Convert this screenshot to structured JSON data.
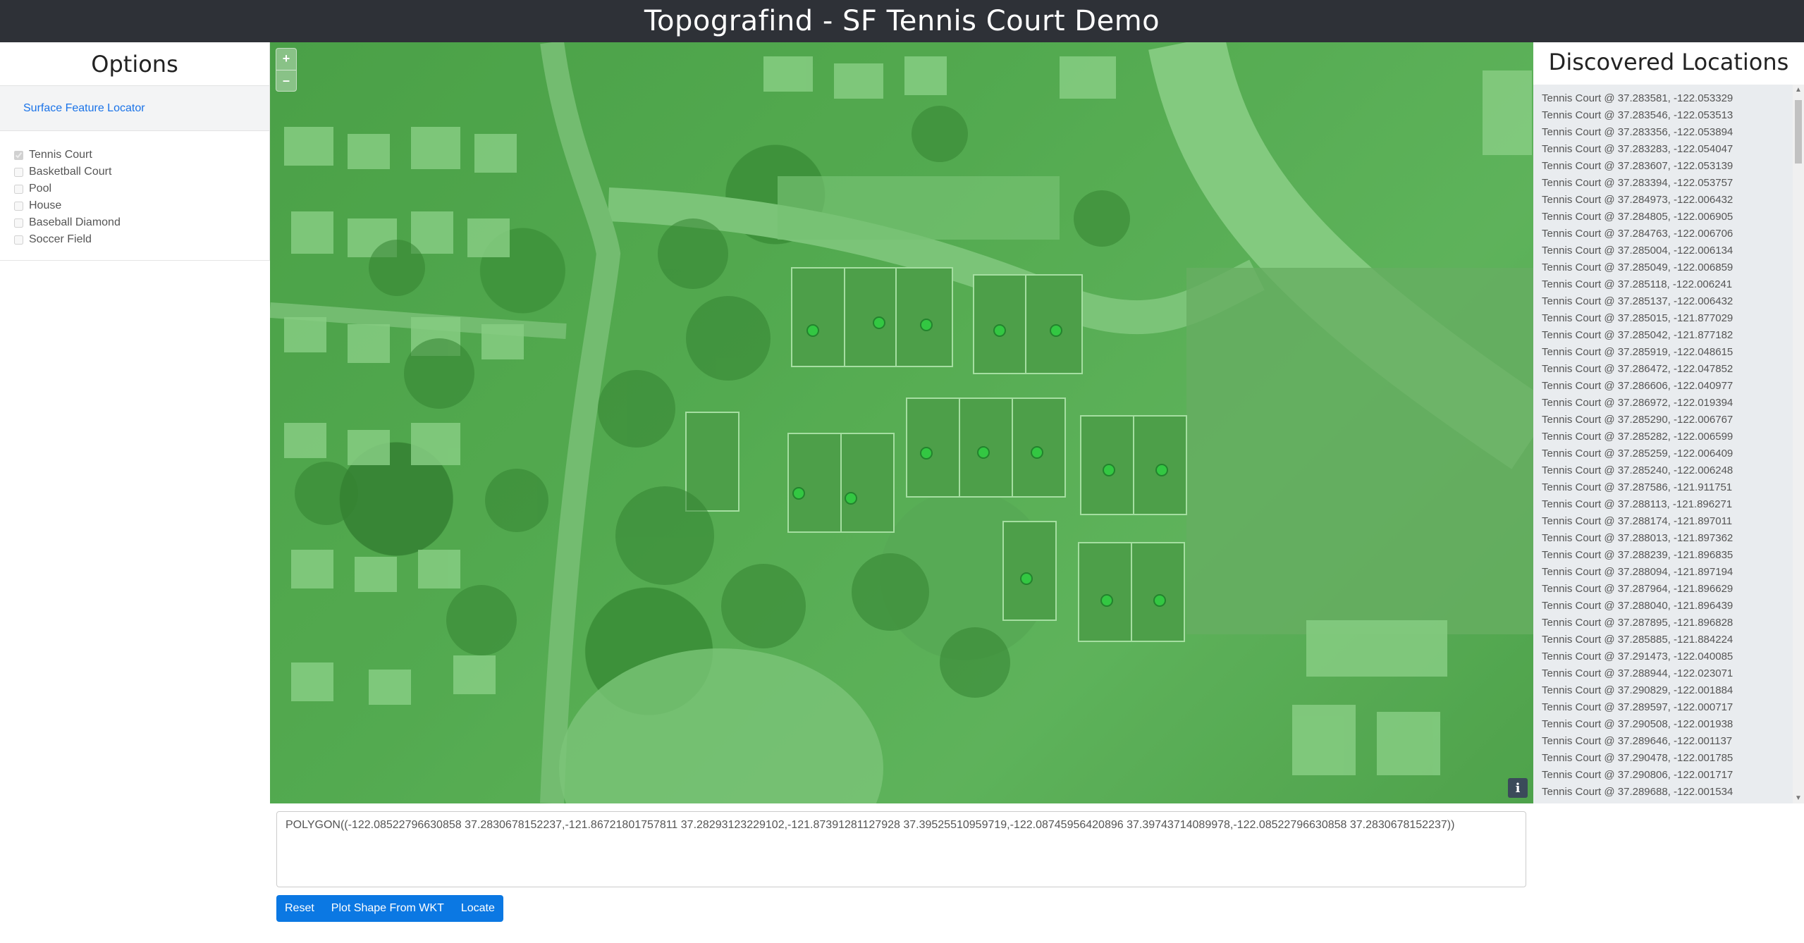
{
  "header": {
    "title": "Topografind - SF Tennis Court Demo"
  },
  "options": {
    "title": "Options",
    "locator_link": "Surface Feature Locator",
    "features": [
      {
        "label": "Tennis Court",
        "checked": true
      },
      {
        "label": "Basketball Court",
        "checked": false
      },
      {
        "label": "Pool",
        "checked": false
      },
      {
        "label": "House",
        "checked": false
      },
      {
        "label": "Baseball Diamond",
        "checked": false
      },
      {
        "label": "Soccer Field",
        "checked": false
      }
    ]
  },
  "map": {
    "zoom_in": "+",
    "zoom_out": "–",
    "info": "i",
    "overlay_color": "#4caf50",
    "marker_color": "#2ecc40"
  },
  "discovered": {
    "title": "Discovered Locations",
    "items": [
      "Tennis Court @ 37.283581, -122.053329",
      "Tennis Court @ 37.283546, -122.053513",
      "Tennis Court @ 37.283356, -122.053894",
      "Tennis Court @ 37.283283, -122.054047",
      "Tennis Court @ 37.283607, -122.053139",
      "Tennis Court @ 37.283394, -122.053757",
      "Tennis Court @ 37.284973, -122.006432",
      "Tennis Court @ 37.284805, -122.006905",
      "Tennis Court @ 37.284763, -122.006706",
      "Tennis Court @ 37.285004, -122.006134",
      "Tennis Court @ 37.285049, -122.006859",
      "Tennis Court @ 37.285118, -122.006241",
      "Tennis Court @ 37.285137, -122.006432",
      "Tennis Court @ 37.285015, -121.877029",
      "Tennis Court @ 37.285042, -121.877182",
      "Tennis Court @ 37.285919, -122.048615",
      "Tennis Court @ 37.286472, -122.047852",
      "Tennis Court @ 37.286606, -122.040977",
      "Tennis Court @ 37.286972, -122.019394",
      "Tennis Court @ 37.285290, -122.006767",
      "Tennis Court @ 37.285282, -122.006599",
      "Tennis Court @ 37.285259, -122.006409",
      "Tennis Court @ 37.285240, -122.006248",
      "Tennis Court @ 37.287586, -121.911751",
      "Tennis Court @ 37.288113, -121.896271",
      "Tennis Court @ 37.288174, -121.897011",
      "Tennis Court @ 37.288013, -121.897362",
      "Tennis Court @ 37.288239, -121.896835",
      "Tennis Court @ 37.288094, -121.897194",
      "Tennis Court @ 37.287964, -121.896629",
      "Tennis Court @ 37.288040, -121.896439",
      "Tennis Court @ 37.287895, -121.896828",
      "Tennis Court @ 37.285885, -121.884224",
      "Tennis Court @ 37.291473, -122.040085",
      "Tennis Court @ 37.288944, -122.023071",
      "Tennis Court @ 37.290829, -122.001884",
      "Tennis Court @ 37.289597, -122.000717",
      "Tennis Court @ 37.290508, -122.001938",
      "Tennis Court @ 37.289646, -122.001137",
      "Tennis Court @ 37.290478, -122.001785",
      "Tennis Court @ 37.290806, -122.001717",
      "Tennis Court @ 37.289688, -122.001534"
    ]
  },
  "wkt": {
    "value": "POLYGON((-122.08522796630858 37.2830678152237,-121.86721801757811 37.28293123229102,-121.87391281127928 37.39525510959719,-122.08745956420896 37.39743714089978,-122.08522796630858 37.2830678152237))"
  },
  "actions": {
    "reset": "Reset",
    "plot": "Plot Shape From WKT",
    "locate": "Locate"
  }
}
